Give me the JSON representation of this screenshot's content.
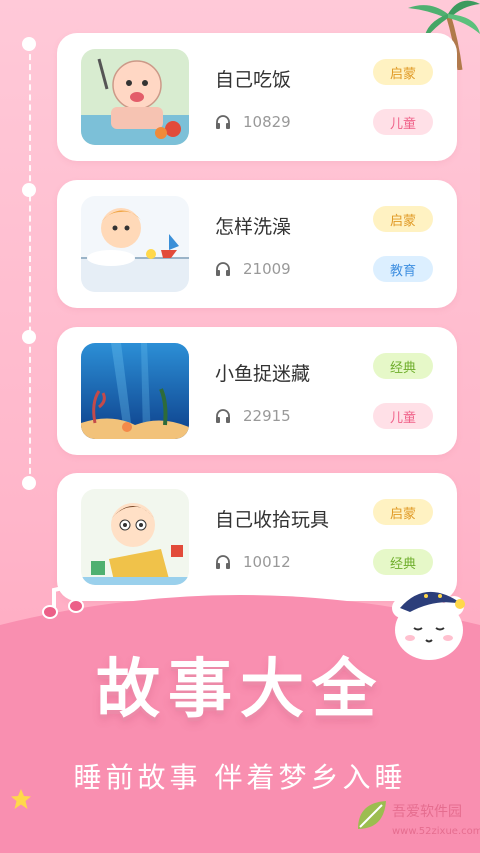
{
  "stories": [
    {
      "title": "自己吃饭",
      "plays": "10829",
      "tags": [
        "启蒙",
        "儿童"
      ]
    },
    {
      "title": "怎样洗澡",
      "plays": "21009",
      "tags": [
        "启蒙",
        "教育"
      ]
    },
    {
      "title": "小鱼捉迷藏",
      "plays": "22915",
      "tags": [
        "经典",
        "儿童"
      ]
    },
    {
      "title": "自己收拾玩具",
      "plays": "10012",
      "tags": [
        "启蒙",
        "经典"
      ]
    }
  ],
  "banner": {
    "title": "故事大全",
    "subtitle": "睡前故事 伴着梦乡入睡"
  },
  "watermark": {
    "text": "吾爱软件园",
    "url": "www.52zixue.com"
  },
  "colors": {
    "background": "#ffc0d2",
    "accent": "#f57fa3"
  }
}
